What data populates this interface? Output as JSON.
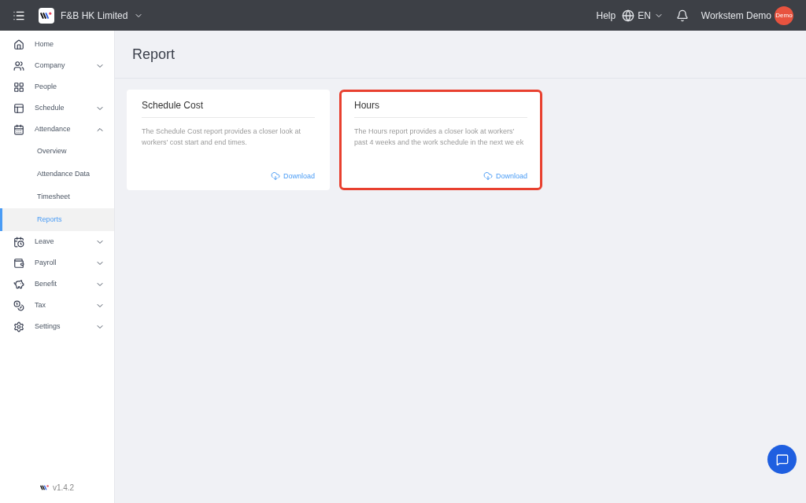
{
  "topbar": {
    "company": "F&B HK Limited",
    "help": "Help",
    "language": "EN",
    "user": "Workstem Demo",
    "avatar": "Demo"
  },
  "sidebar": {
    "items": [
      {
        "label": "Home",
        "expandable": false
      },
      {
        "label": "Company",
        "expandable": true,
        "expanded": false
      },
      {
        "label": "People",
        "expandable": false
      },
      {
        "label": "Schedule",
        "expandable": true,
        "expanded": false
      },
      {
        "label": "Attendance",
        "expandable": true,
        "expanded": true,
        "children": [
          {
            "label": "Overview",
            "selected": false
          },
          {
            "label": "Attendance Data",
            "selected": false
          },
          {
            "label": "Timesheet",
            "selected": false
          },
          {
            "label": "Reports",
            "selected": true
          }
        ]
      },
      {
        "label": "Leave",
        "expandable": true,
        "expanded": false
      },
      {
        "label": "Payroll",
        "expandable": true,
        "expanded": false
      },
      {
        "label": "Benefit",
        "expandable": true,
        "expanded": false
      },
      {
        "label": "Tax",
        "expandable": true,
        "expanded": false
      },
      {
        "label": "Settings",
        "expandable": true,
        "expanded": false
      }
    ],
    "version": "v1.4.2"
  },
  "page": {
    "title": "Report"
  },
  "cards": [
    {
      "title": "Schedule Cost",
      "description": "The Schedule Cost report provides a closer look at workers' cost start and end times.",
      "action": "Download",
      "highlighted": false
    },
    {
      "title": "Hours",
      "description": "The Hours report provides a closer look at workers' past 4 weeks and the work schedule in the next we ek",
      "action": "Download",
      "highlighted": true
    }
  ]
}
